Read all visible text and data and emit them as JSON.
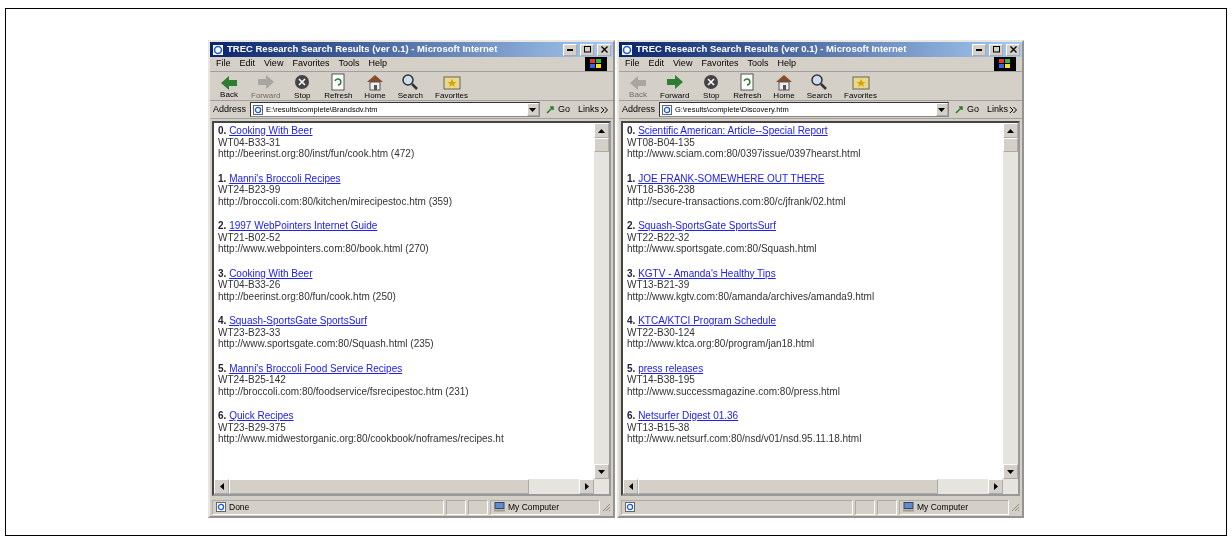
{
  "windows": [
    {
      "title": "TREC Research Search Results (ver 0.1) - Microsoft Internet",
      "menu": [
        "File",
        "Edit",
        "View",
        "Favorites",
        "Tools",
        "Help"
      ],
      "toolbar": [
        {
          "kind": "back",
          "label": "Back",
          "disabled": false
        },
        {
          "kind": "forward",
          "label": "Forward",
          "disabled": true
        },
        {
          "kind": "stop",
          "label": "Stop",
          "disabled": false
        },
        {
          "kind": "refresh",
          "label": "Refresh",
          "disabled": false
        },
        {
          "kind": "home",
          "label": "Home",
          "disabled": false
        },
        {
          "kind": "search",
          "label": "Search",
          "disabled": false
        },
        {
          "kind": "favorites",
          "label": "Favorites",
          "disabled": false
        }
      ],
      "address": {
        "label": "Address",
        "value": "E:\\results\\complete\\Brandsdv.htm"
      },
      "go": "Go",
      "links": "Links",
      "results": [
        {
          "number": "0.",
          "title": "Cooking With Beer",
          "id": "WT04-B33-31",
          "url": "http://beerinst.org:80/inst/fun/cook.htm (472)"
        },
        {
          "number": "1.",
          "title": "Manni's Broccoli Recipes",
          "id": "WT24-B23-99",
          "url": "http://broccoli.com:80/kitchen/mirecipestoc.htm (359)"
        },
        {
          "number": "2.",
          "title": "1997 WebPointers Internet Guide",
          "id": "WT21-B02-52",
          "url": "http://www.webpointers.com:80/book.html (270)"
        },
        {
          "number": "3.",
          "title": "Cooking With Beer",
          "id": "WT04-B33-26",
          "url": "http://beerinst.org:80/fun/cook.htm (250)"
        },
        {
          "number": "4.",
          "title": "Squash-SportsGate SportsSurf",
          "id": "WT23-B23-33",
          "url": "http://www.sportsgate.com:80/Squash.html (235)"
        },
        {
          "number": "5.",
          "title": "Manni's Broccoli Food Service Recipes",
          "id": "WT24-B25-142",
          "url": "http://broccoli.com:80/foodservice/fsrecipestoc.htm (231)"
        },
        {
          "number": "6.",
          "title": "Quick Recipes",
          "id": "WT23-B29-375",
          "url": "http://www.midwestorganic.org:80/cookbook/noframes/recipes.ht"
        }
      ],
      "status": {
        "text": "Done",
        "zone": "My Computer"
      }
    },
    {
      "title": "TREC Research Search Results (ver 0.1) - Microsoft Internet",
      "menu": [
        "File",
        "Edit",
        "View",
        "Favorites",
        "Tools",
        "Help"
      ],
      "toolbar": [
        {
          "kind": "back",
          "label": "Back",
          "disabled": true
        },
        {
          "kind": "forward",
          "label": "Forward",
          "disabled": false
        },
        {
          "kind": "stop",
          "label": "Stop",
          "disabled": false
        },
        {
          "kind": "refresh",
          "label": "Refresh",
          "disabled": false
        },
        {
          "kind": "home",
          "label": "Home",
          "disabled": false
        },
        {
          "kind": "search",
          "label": "Search",
          "disabled": false
        },
        {
          "kind": "favorites",
          "label": "Favorites",
          "disabled": false
        }
      ],
      "address": {
        "label": "Address",
        "value": "G:\\results\\complete\\Discovery.htm"
      },
      "go": "Go",
      "links": "Links",
      "results": [
        {
          "number": "0.",
          "title": "Scientific American: Article--Special Report",
          "id": "WT08-B04-135",
          "url": "http://www.sciam.com:80/0397issue/0397hearst.html"
        },
        {
          "number": "1.",
          "title": "JOE FRANK-SOMEWHERE OUT THERE",
          "id": "WT18-B36-238",
          "url": "http://secure-transactions.com:80/c/jfrank/02.html"
        },
        {
          "number": "2.",
          "title": "Squash-SportsGate SportsSurf",
          "id": "WT22-B22-32",
          "url": "http://www.sportsgate.com:80/Squash.html"
        },
        {
          "number": "3.",
          "title": "KGTV - Amanda's Healthy Tips",
          "id": "WT13-B21-39",
          "url": "http://www.kgtv.com:80/amanda/archives/amanda9.html"
        },
        {
          "number": "4.",
          "title": "KTCA/KTCI Program Schedule",
          "id": "WT22-B30-124",
          "url": "http://www.ktca.org:80/program/jan18.html"
        },
        {
          "number": "5.",
          "title": "press releases",
          "id": "WT14-B38-195",
          "url": "http://www.successmagazine.com:80/press.html"
        },
        {
          "number": "6.",
          "title": "Netsurfer Digest 01.36",
          "id": "WT13-B15-38",
          "url": "http://www.netsurf.com:80/nsd/v01/nsd.95.11.18.html"
        }
      ],
      "status": {
        "zone": "My Computer"
      }
    }
  ]
}
